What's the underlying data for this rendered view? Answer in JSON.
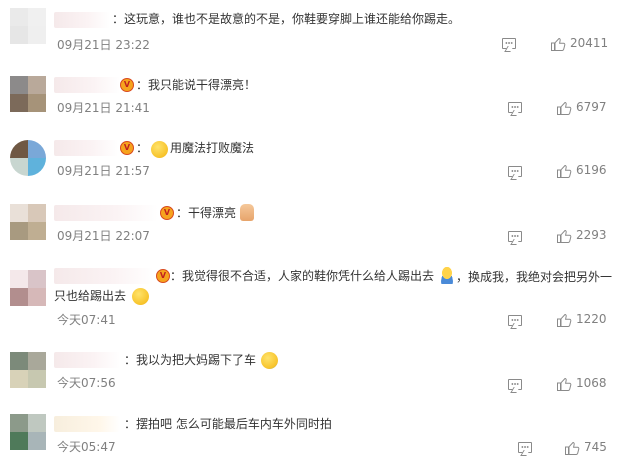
{
  "comments": [
    {
      "text": "：这玩意，谁也不是故意的不是，你鞋要穿脚上谁还能给你踢走。",
      "time": "09月21日 23:22",
      "likes": "20411",
      "has_vip": false,
      "avatar_colors": [
        "#eaeaea",
        "#f0f0f0",
        "#e6e6e6",
        "#efefef"
      ]
    },
    {
      "text": "：我只能说干得漂亮！",
      "time": "09月21日 21:41",
      "likes": "6797",
      "has_vip": true,
      "avatar_colors": [
        "#8c8a8a",
        "#b9a99a",
        "#7c6a5a",
        "#a69379"
      ]
    },
    {
      "text": "用魔法打败魔法",
      "time": "09月21日 21:57",
      "likes": "6196",
      "has_vip": true,
      "avatar_colors": [
        "#6f5844",
        "#7aa8d8",
        "#c8d6d0",
        "#5fb2dc"
      ]
    },
    {
      "text": "干得漂亮",
      "time": "09月21日 22:07",
      "likes": "2293",
      "has_vip": true,
      "avatar_colors": [
        "#e9e0d8",
        "#d8c8b8",
        "#a89a80",
        "#bfae92"
      ]
    },
    {
      "text_a": "：我觉得很不合适，人家的鞋你凭什么给人踢出去",
      "text_b": "，换成我，我绝对会把另外一只也给踢出去",
      "time": "今天07:41",
      "likes": "1220",
      "has_vip": true,
      "avatar_colors": [
        "#f4e8ea",
        "#d9c4c8",
        "#b28e8e",
        "#d6b8b8"
      ]
    },
    {
      "text": "：我以为把大妈踢下了车",
      "time": "今天07:56",
      "likes": "1068",
      "has_vip": false,
      "avatar_colors": [
        "#7c8a7a",
        "#a9a89a",
        "#d8d2b8",
        "#c7c8b0"
      ]
    },
    {
      "text": "：摆拍吧 怎么可能最后车内车外同时拍",
      "time": "今天05:47",
      "likes": "745",
      "has_vip": false,
      "avatar_colors": [
        "#8c9a8a",
        "#bfc8c0",
        "#4f7a5a",
        "#a8b5b8"
      ]
    }
  ],
  "icons": {
    "comment": "comment-icon",
    "like": "thumbs-up-icon",
    "vip": "vip-badge-icon"
  },
  "colors": {
    "text": "#333333",
    "meta": "#808080",
    "vip": "#f6a31d"
  }
}
